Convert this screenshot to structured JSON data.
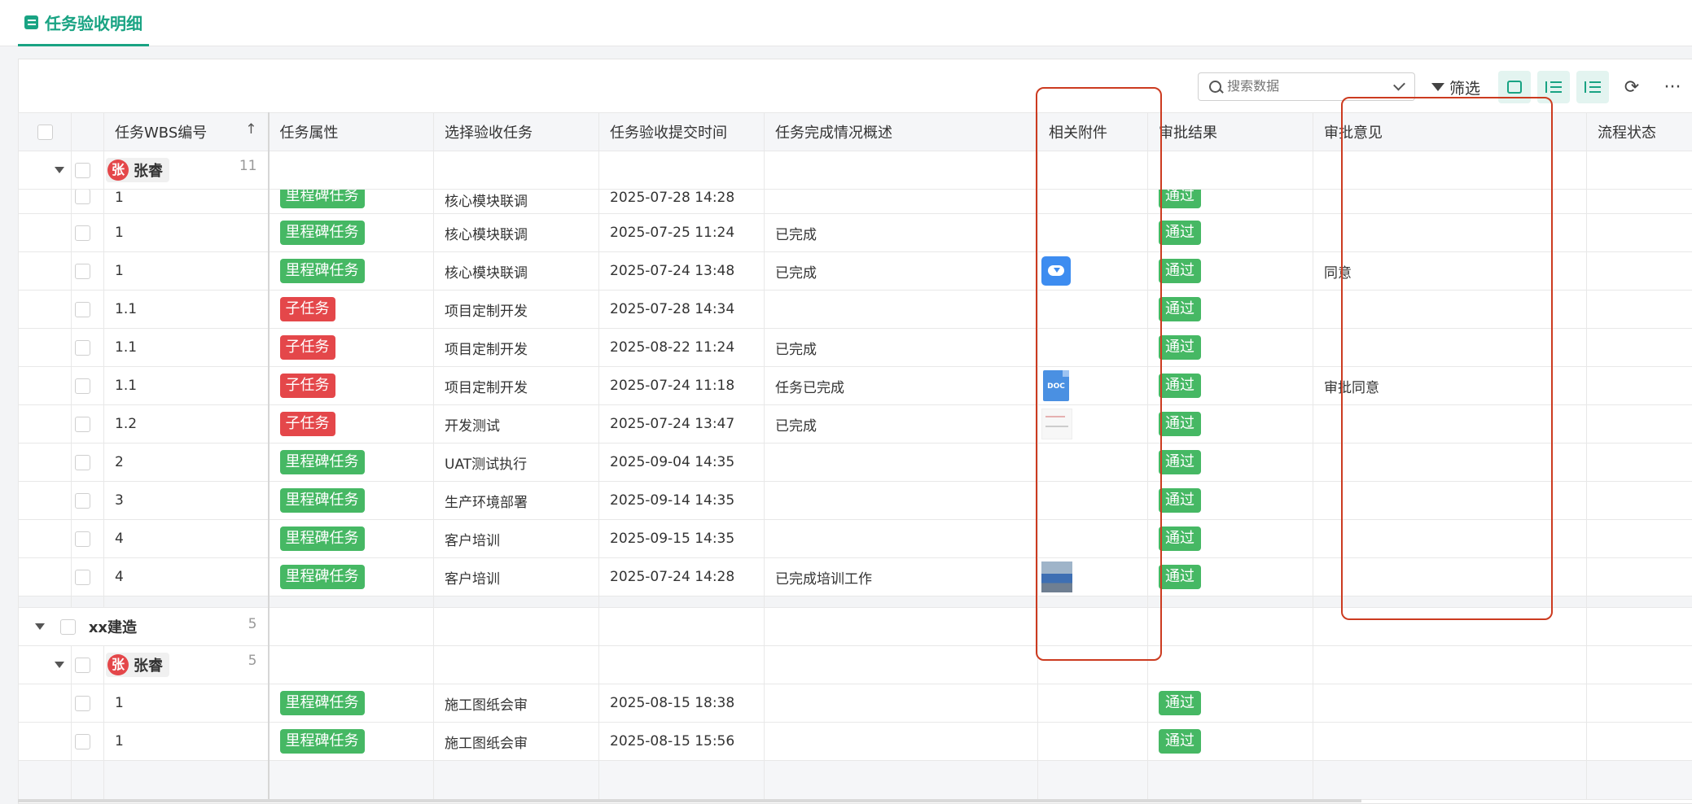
{
  "tab": {
    "label": "任务验收明细",
    "icon": "list-icon"
  },
  "toolbar": {
    "search_placeholder": "搜索数据",
    "filter_label": "筛选",
    "buttons": [
      "sticky-note-icon",
      "sort-tree-icon",
      "group-list-icon",
      "refresh-icon",
      "more-icon"
    ]
  },
  "columns": {
    "wbs": "任务WBS编号",
    "attr": "任务属性",
    "task": "选择验收任务",
    "time": "任务验收提交时间",
    "summary": "任务完成情况概述",
    "attach": "相关附件",
    "result": "审批结果",
    "opinion": "审批意见",
    "status": "流程状态",
    "sort_arrow": "↑"
  },
  "groups": [
    {
      "person": {
        "avatar": "张",
        "name": "张睿",
        "count": "11"
      },
      "rows": [
        {
          "wbs": "1",
          "attr": "里程碑任务",
          "task": "核心模块联调",
          "time": "2025-07-28 14:28",
          "summary": "",
          "result": "通过",
          "opinion": ""
        },
        {
          "wbs": "1",
          "attr": "里程碑任务",
          "task": "核心模块联调",
          "time": "2025-07-25 11:24",
          "summary": "已完成",
          "result": "通过",
          "opinion": ""
        },
        {
          "wbs": "1",
          "attr": "里程碑任务",
          "task": "核心模块联调",
          "time": "2025-07-24 13:48",
          "summary": "已完成",
          "result": "通过",
          "opinion": "同意"
        },
        {
          "wbs": "1.1",
          "attr": "子任务",
          "task": "项目定制开发",
          "time": "2025-07-28 14:34",
          "summary": "",
          "result": "通过",
          "opinion": ""
        },
        {
          "wbs": "1.1",
          "attr": "子任务",
          "task": "项目定制开发",
          "time": "2025-08-22 11:24",
          "summary": "已完成",
          "result": "通过",
          "opinion": ""
        },
        {
          "wbs": "1.1",
          "attr": "子任务",
          "task": "项目定制开发",
          "time": "2025-07-24 11:18",
          "summary": "任务已完成",
          "result": "通过",
          "opinion": "审批同意"
        },
        {
          "wbs": "1.2",
          "attr": "子任务",
          "task": "开发测试",
          "time": "2025-07-24 13:47",
          "summary": "已完成",
          "result": "通过",
          "opinion": ""
        },
        {
          "wbs": "2",
          "attr": "里程碑任务",
          "task": "UAT测试执行",
          "time": "2025-09-04 14:35",
          "summary": "",
          "result": "通过",
          "opinion": ""
        },
        {
          "wbs": "3",
          "attr": "里程碑任务",
          "task": "生产环境部署",
          "time": "2025-09-14 14:35",
          "summary": "",
          "result": "通过",
          "opinion": ""
        },
        {
          "wbs": "4",
          "attr": "里程碑任务",
          "task": "客户培训",
          "time": "2025-09-15 14:35",
          "summary": "",
          "result": "通过",
          "opinion": ""
        },
        {
          "wbs": "4",
          "attr": "里程碑任务",
          "task": "客户培训",
          "time": "2025-07-24 14:28",
          "summary": "已完成培训工作",
          "result": "通过",
          "opinion": ""
        }
      ]
    },
    {
      "name": "xx建造",
      "count": "5",
      "person": {
        "avatar": "张",
        "name": "张睿",
        "count": "5"
      },
      "rows": [
        {
          "wbs": "1",
          "attr": "里程碑任务",
          "task": "施工图纸会审",
          "time": "2025-08-15 18:38",
          "result": "通过"
        },
        {
          "wbs": "1",
          "attr": "里程碑任务",
          "task": "施工图纸会审",
          "time": "2025-08-15 15:56",
          "result": "通过"
        }
      ]
    }
  ],
  "attachments": {
    "cloud": "cloud-upload-icon",
    "doc_label": "DOC",
    "doc": "doc-file-icon",
    "image1": "document-thumbnail",
    "image2": "photo-thumbnail"
  },
  "colors": {
    "accent": "#19a383",
    "tag_green": "#46b864",
    "tag_red": "#e4474a",
    "highlight_border": "#cc3b20"
  }
}
